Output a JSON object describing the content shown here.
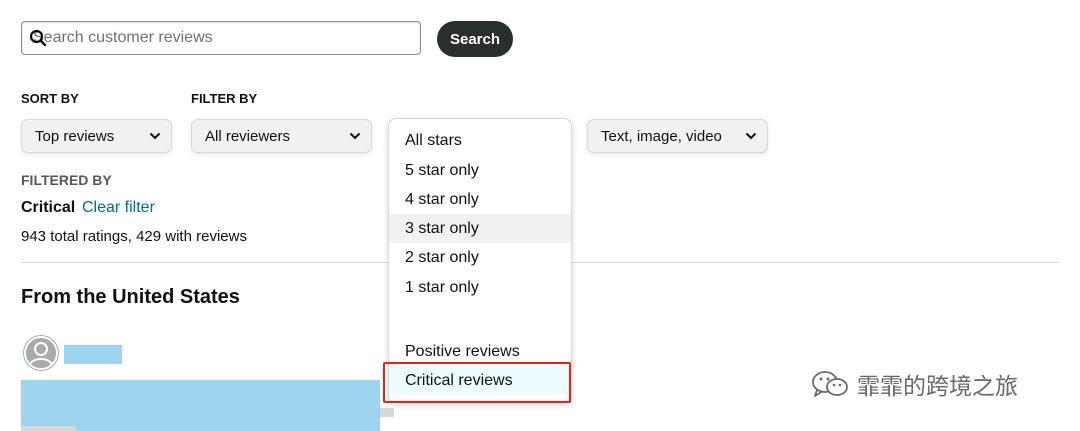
{
  "search": {
    "placeholder": "Search customer reviews",
    "button_label": "Search"
  },
  "sort": {
    "label": "SORT BY",
    "selected": "Top reviews"
  },
  "filter": {
    "label": "FILTER BY",
    "reviewers_selected": "All reviewers",
    "media_selected": "Text, image, video"
  },
  "star_menu": {
    "items": [
      "All stars",
      "5 star only",
      "4 star only",
      "3 star only",
      "2 star only",
      "1 star only",
      "Positive reviews",
      "Critical reviews"
    ],
    "hovered": "3 star only",
    "selected": "Critical reviews"
  },
  "filtered_by": {
    "label": "FILTERED BY",
    "value": "Critical",
    "clear_label": "Clear filter",
    "summary": "943 total ratings, 429 with reviews"
  },
  "reviews": {
    "section_title": "From the United States"
  },
  "watermark": {
    "text": "霏霏的跨境之旅"
  },
  "colors": {
    "link": "#007185",
    "search_button_bg": "#2b2e2e",
    "dropdown_bg": "#f0f2f2",
    "highlight_border": "#e2231a",
    "redaction": "#9bd4ec"
  }
}
